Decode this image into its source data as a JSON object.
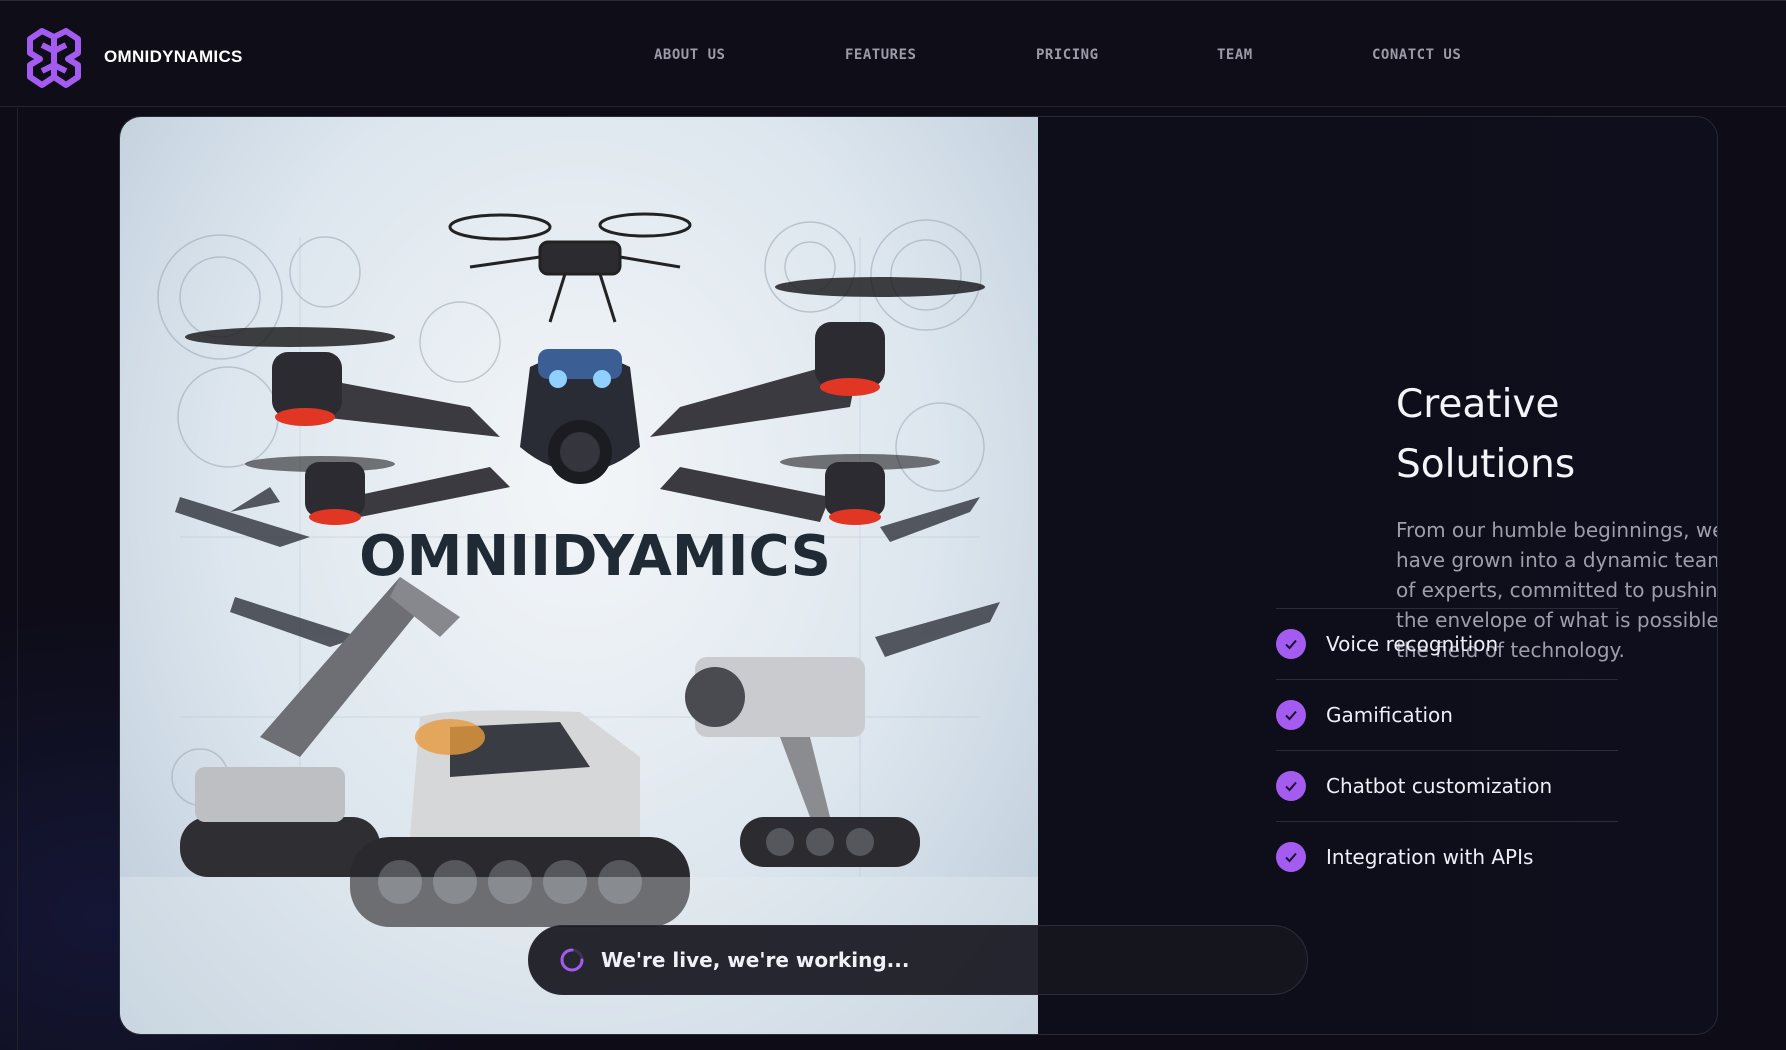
{
  "brand": {
    "name": "OMNIDYNAMICS",
    "logo_icon": "knot-logo-icon",
    "accent": "#a45cf0"
  },
  "nav": [
    {
      "label": "ABOUT US"
    },
    {
      "label": "FEATURES"
    },
    {
      "label": "PRICING"
    },
    {
      "label": "TEAM"
    },
    {
      "label": "CONATCT US"
    }
  ],
  "hero": {
    "image_text": "OMNIIDYAMICS",
    "image_subject": "drones and tracked robots"
  },
  "content": {
    "title_line1": "Creative",
    "title_line2": "Solutions",
    "description": "From our humble beginnings, we have grown into a dynamic team of experts, committed to pushing the envelope of what is possible in the field of technology.",
    "features": [
      {
        "label": "Voice recognition",
        "icon": "check-icon"
      },
      {
        "label": "Gamification",
        "icon": "check-icon"
      },
      {
        "label": "Chatbot customization",
        "icon": "check-icon"
      },
      {
        "label": "Integration with APIs",
        "icon": "check-icon"
      }
    ]
  },
  "toast": {
    "text": "We're live, we're working...",
    "icon": "spinner-icon"
  }
}
